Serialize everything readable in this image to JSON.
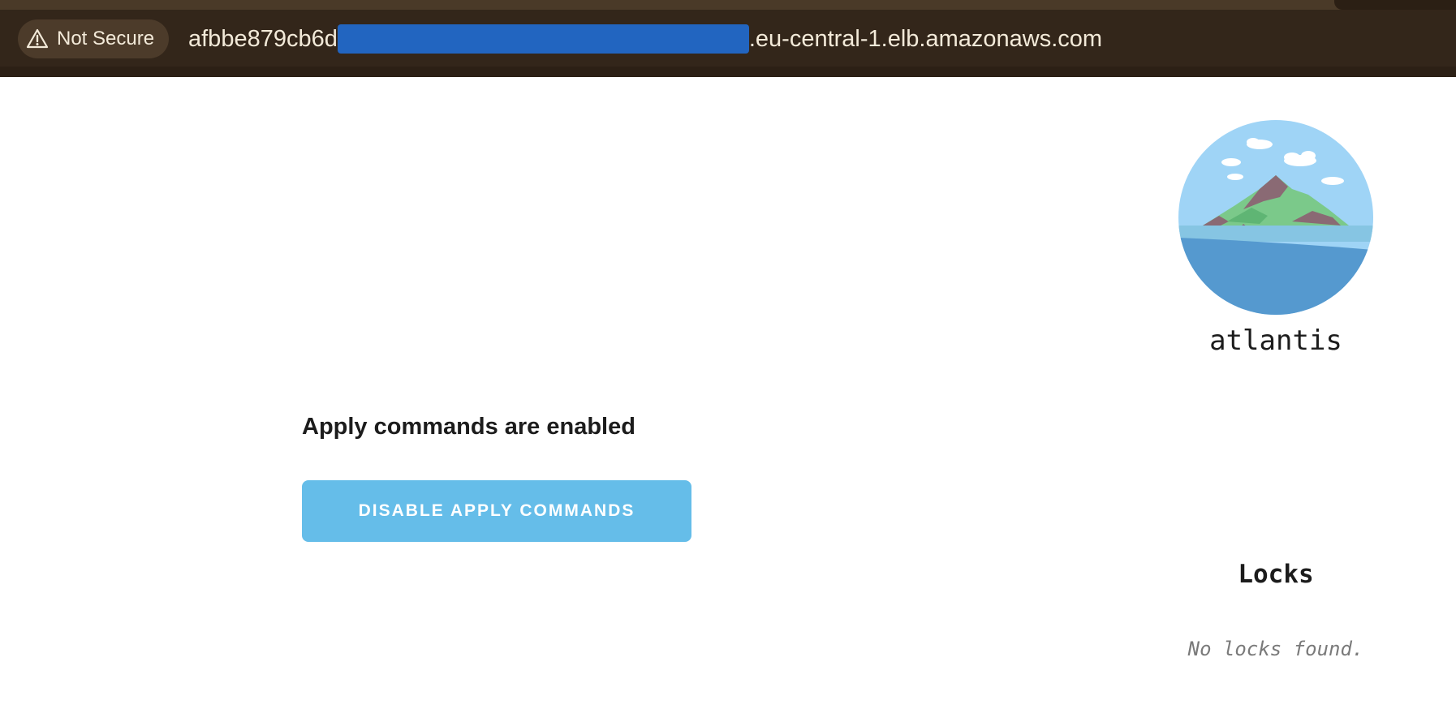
{
  "browser": {
    "security_label": "Not Secure",
    "security_icon": "warning-triangle-icon",
    "url_prefix": "afbbe879cb6d",
    "url_suffix": ".eu-central-1.elb.amazonaws.com"
  },
  "main": {
    "status_text": "Apply commands are enabled",
    "disable_button_label": "DISABLE APPLY COMMANDS"
  },
  "sidebar": {
    "app_name": "atlantis",
    "locks_title": "Locks",
    "locks_empty_text": "No locks found."
  },
  "colors": {
    "topbar": "#33261a",
    "button": "#65bde9",
    "redaction": "#2265c0"
  }
}
